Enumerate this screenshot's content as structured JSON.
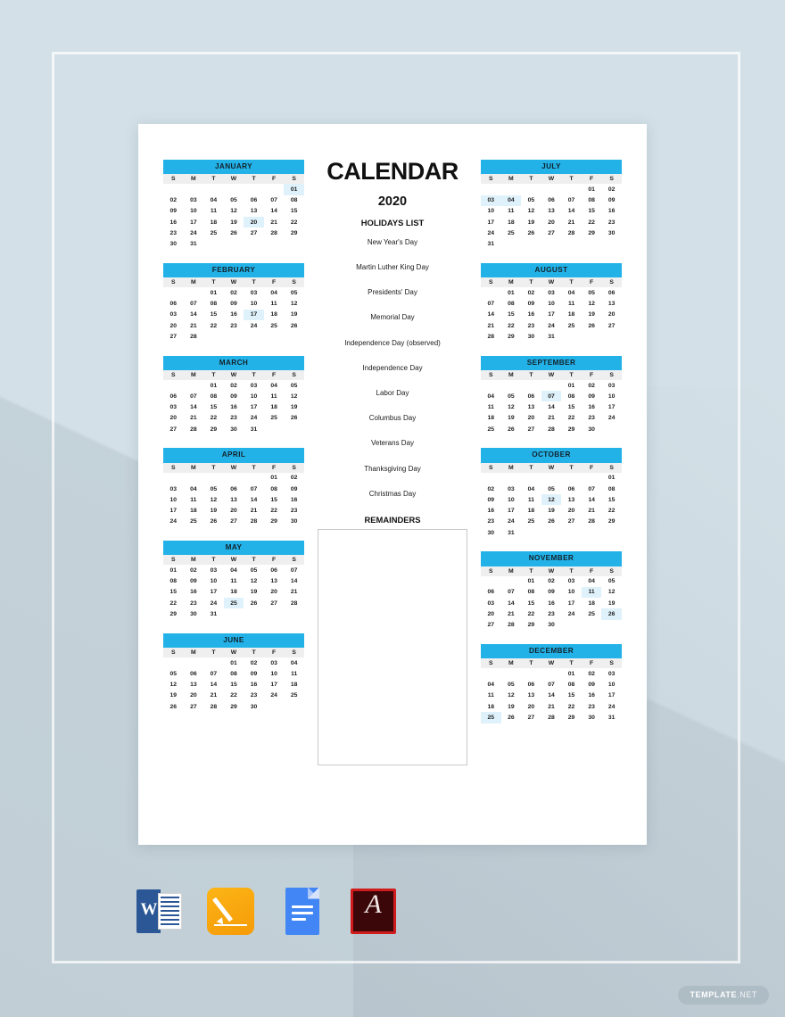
{
  "document": {
    "title": "CALENDAR",
    "year": "2020",
    "holidays_heading": "HOLIDAYS LIST",
    "remainders_heading": "REMAINDERS",
    "accent_color": "#22b2e8",
    "highlight_color": "#dff2fb",
    "header_row_color": "#efefef",
    "page_background": "#d3e0e7"
  },
  "weekday_headers": [
    "S",
    "M",
    "T",
    "W",
    "T",
    "F",
    "S"
  ],
  "holidays": [
    "New Year's Day",
    "Martin Luther King Day",
    "Presidents' Day",
    "Memorial Day",
    "Independence Day (observed)",
    "Independence Day",
    "Labor Day",
    "Columbus Day",
    "Veterans Day",
    "Thanksgiving Day",
    "Christmas Day"
  ],
  "months_left": [
    {
      "name": "JANUARY",
      "weeks": [
        [
          "",
          "",
          "",
          "",
          "",
          "",
          "01"
        ],
        [
          "02",
          "03",
          "04",
          "05",
          "06",
          "07",
          "08"
        ],
        [
          "09",
          "10",
          "11",
          "12",
          "13",
          "14",
          "15"
        ],
        [
          "16",
          "17",
          "18",
          "19",
          "20",
          "21",
          "22"
        ],
        [
          "23",
          "24",
          "25",
          "26",
          "27",
          "28",
          "29"
        ],
        [
          "30",
          "31",
          "",
          "",
          "",
          "",
          ""
        ]
      ],
      "highlighted": [
        "01",
        "20"
      ]
    },
    {
      "name": "FEBRUARY",
      "weeks": [
        [
          "",
          "",
          "01",
          "02",
          "03",
          "04",
          "05"
        ],
        [
          "06",
          "07",
          "08",
          "09",
          "10",
          "11",
          "12"
        ],
        [
          "03",
          "14",
          "15",
          "16",
          "17",
          "18",
          "19"
        ],
        [
          "20",
          "21",
          "22",
          "23",
          "24",
          "25",
          "26"
        ],
        [
          "27",
          "28",
          "",
          "",
          "",
          "",
          ""
        ]
      ],
      "highlighted": [
        "17"
      ]
    },
    {
      "name": "MARCH",
      "weeks": [
        [
          "",
          "",
          "01",
          "02",
          "03",
          "04",
          "05"
        ],
        [
          "06",
          "07",
          "08",
          "09",
          "10",
          "11",
          "12"
        ],
        [
          "03",
          "14",
          "15",
          "16",
          "17",
          "18",
          "19"
        ],
        [
          "20",
          "21",
          "22",
          "23",
          "24",
          "25",
          "26"
        ],
        [
          "27",
          "28",
          "29",
          "30",
          "31",
          "",
          ""
        ]
      ],
      "highlighted": []
    },
    {
      "name": "APRIL",
      "weeks": [
        [
          "",
          "",
          "",
          "",
          "",
          "01",
          "02"
        ],
        [
          "03",
          "04",
          "05",
          "06",
          "07",
          "08",
          "09"
        ],
        [
          "10",
          "11",
          "12",
          "13",
          "14",
          "15",
          "16"
        ],
        [
          "17",
          "18",
          "19",
          "20",
          "21",
          "22",
          "23"
        ],
        [
          "24",
          "25",
          "26",
          "27",
          "28",
          "29",
          "30"
        ]
      ],
      "highlighted": []
    },
    {
      "name": "MAY",
      "weeks": [
        [
          "01",
          "02",
          "03",
          "04",
          "05",
          "06",
          "07"
        ],
        [
          "08",
          "09",
          "10",
          "11",
          "12",
          "13",
          "14"
        ],
        [
          "15",
          "16",
          "17",
          "18",
          "19",
          "20",
          "21"
        ],
        [
          "22",
          "23",
          "24",
          "25",
          "26",
          "27",
          "28"
        ],
        [
          "29",
          "30",
          "31",
          "",
          "",
          "",
          ""
        ]
      ],
      "highlighted": [
        "25"
      ]
    },
    {
      "name": "JUNE",
      "weeks": [
        [
          "",
          "",
          "",
          "01",
          "02",
          "03",
          "04"
        ],
        [
          "05",
          "06",
          "07",
          "08",
          "09",
          "10",
          "11"
        ],
        [
          "12",
          "13",
          "14",
          "15",
          "16",
          "17",
          "18"
        ],
        [
          "19",
          "20",
          "21",
          "22",
          "23",
          "24",
          "25"
        ],
        [
          "26",
          "27",
          "28",
          "29",
          "30",
          "",
          ""
        ]
      ],
      "highlighted": []
    }
  ],
  "months_right": [
    {
      "name": "JULY",
      "weeks": [
        [
          "",
          "",
          "",
          "",
          "",
          "01",
          "02"
        ],
        [
          "03",
          "04",
          "05",
          "06",
          "07",
          "08",
          "09"
        ],
        [
          "10",
          "11",
          "12",
          "13",
          "14",
          "15",
          "16"
        ],
        [
          "17",
          "18",
          "19",
          "20",
          "21",
          "22",
          "23"
        ],
        [
          "24",
          "25",
          "26",
          "27",
          "28",
          "29",
          "30"
        ],
        [
          "31",
          "",
          "",
          "",
          "",
          "",
          ""
        ]
      ],
      "highlighted": [
        "03",
        "04"
      ]
    },
    {
      "name": "AUGUST",
      "weeks": [
        [
          "",
          "01",
          "02",
          "03",
          "04",
          "05",
          "06"
        ],
        [
          "07",
          "08",
          "09",
          "10",
          "11",
          "12",
          "13"
        ],
        [
          "14",
          "15",
          "16",
          "17",
          "18",
          "19",
          "20"
        ],
        [
          "21",
          "22",
          "23",
          "24",
          "25",
          "26",
          "27"
        ],
        [
          "28",
          "29",
          "30",
          "31",
          "",
          "",
          ""
        ]
      ],
      "highlighted": []
    },
    {
      "name": "SEPTEMBER",
      "weeks": [
        [
          "",
          "",
          "",
          "",
          "01",
          "02",
          "03"
        ],
        [
          "04",
          "05",
          "06",
          "07",
          "08",
          "09",
          "10"
        ],
        [
          "11",
          "12",
          "13",
          "14",
          "15",
          "16",
          "17"
        ],
        [
          "18",
          "19",
          "20",
          "21",
          "22",
          "23",
          "24"
        ],
        [
          "25",
          "26",
          "27",
          "28",
          "29",
          "30",
          ""
        ]
      ],
      "highlighted": [
        "07"
      ]
    },
    {
      "name": "OCTOBER",
      "weeks": [
        [
          "",
          "",
          "",
          "",
          "",
          "",
          "01"
        ],
        [
          "02",
          "03",
          "04",
          "05",
          "06",
          "07",
          "08"
        ],
        [
          "09",
          "10",
          "11",
          "12",
          "13",
          "14",
          "15"
        ],
        [
          "16",
          "17",
          "18",
          "19",
          "20",
          "21",
          "22"
        ],
        [
          "23",
          "24",
          "25",
          "26",
          "27",
          "28",
          "29"
        ],
        [
          "30",
          "31",
          "",
          "",
          "",
          "",
          ""
        ]
      ],
      "highlighted": [
        "12"
      ]
    },
    {
      "name": "NOVEMBER",
      "weeks": [
        [
          "",
          "",
          "01",
          "02",
          "03",
          "04",
          "05"
        ],
        [
          "06",
          "07",
          "08",
          "09",
          "10",
          "11",
          "12"
        ],
        [
          "03",
          "14",
          "15",
          "16",
          "17",
          "18",
          "19"
        ],
        [
          "20",
          "21",
          "22",
          "23",
          "24",
          "25",
          "26"
        ],
        [
          "27",
          "28",
          "29",
          "30",
          "",
          "",
          ""
        ]
      ],
      "highlighted": [
        "11",
        "26"
      ]
    },
    {
      "name": "DECEMBER",
      "weeks": [
        [
          "",
          "",
          "",
          "",
          "01",
          "02",
          "03"
        ],
        [
          "04",
          "05",
          "06",
          "07",
          "08",
          "09",
          "10"
        ],
        [
          "11",
          "12",
          "13",
          "14",
          "15",
          "16",
          "17"
        ],
        [
          "18",
          "19",
          "20",
          "21",
          "22",
          "23",
          "24"
        ],
        [
          "25",
          "26",
          "27",
          "28",
          "29",
          "30",
          "31"
        ]
      ],
      "highlighted": [
        "25"
      ]
    }
  ],
  "app_icons": [
    {
      "name": "microsoft-word-icon",
      "label": "W"
    },
    {
      "name": "apple-pages-icon",
      "label": ""
    },
    {
      "name": "google-docs-icon",
      "label": ""
    },
    {
      "name": "adobe-pdf-icon",
      "label": "A"
    }
  ],
  "watermark": {
    "brand": "TEMPLATE",
    "suffix": ".NET"
  }
}
